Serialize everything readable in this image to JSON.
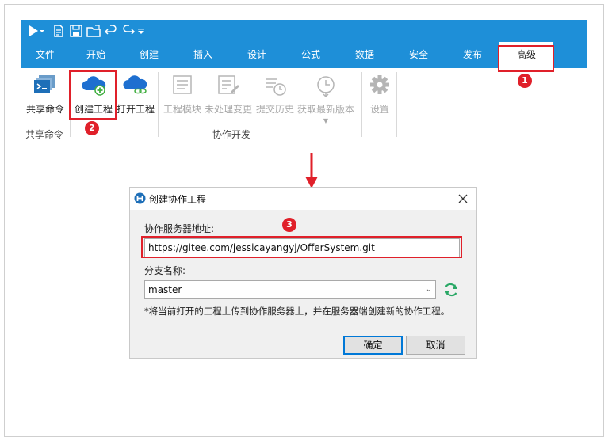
{
  "ribbon": {
    "tabs": [
      "文件",
      "开始",
      "创建",
      "插入",
      "设计",
      "公式",
      "数据",
      "安全",
      "发布",
      "高级"
    ],
    "active_tab": "高级",
    "buttons": {
      "shared_commands": "共享命令",
      "create_project": "创建工程",
      "open_project": "打开工程",
      "project_module": "工程模块",
      "unprocessed_changes": "未处理变更",
      "commit_history": "提交历史",
      "get_latest": "获取最新版本",
      "settings": "设置"
    },
    "groups": {
      "shared_commands": "共享命令",
      "collab_dev": "协作开发"
    },
    "colors": {
      "accent": "#1e8fd8",
      "highlight": "#e0202a"
    }
  },
  "markers": [
    "1",
    "2",
    "3"
  ],
  "dialog": {
    "title": "创建协作工程",
    "server_label": "协作服务器地址:",
    "server_value": "https://gitee.com/jessicayangyj/OfferSystem.git",
    "branch_label": "分支名称:",
    "branch_value": "master",
    "note": "*将当前打开的工程上传到协作服务器上，并在服务器端创建新的协作工程。",
    "ok": "确定",
    "cancel": "取消"
  }
}
